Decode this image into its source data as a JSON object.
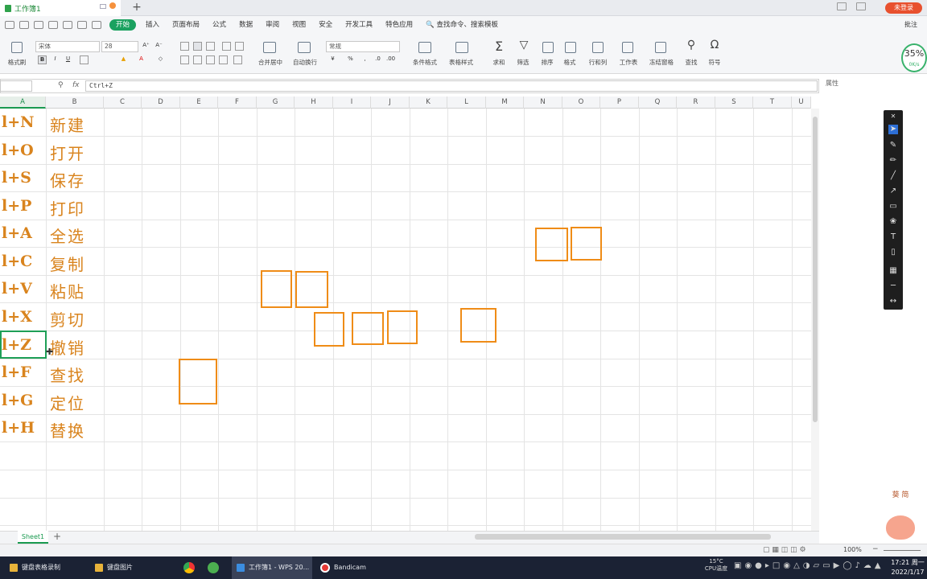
{
  "title_bar": {
    "doc_tab": "工作簿1",
    "login": "未登录"
  },
  "menu": {
    "items": [
      "开始",
      "插入",
      "页面布局",
      "公式",
      "数据",
      "审阅",
      "视图",
      "安全",
      "开发工具",
      "特色应用"
    ],
    "active": "开始",
    "search": "查找命令、搜索模板",
    "annotate": "批注"
  },
  "ribbon": {
    "format_painter": "格式刷",
    "font_name": "宋体",
    "font_size": "28",
    "merge": "合并居中",
    "wrap": "自动换行",
    "number_format": "常规",
    "cond_format": "条件格式",
    "table_style": "表格样式",
    "sum": "求和",
    "filter": "筛选",
    "sort": "排序",
    "format": "格式",
    "rowcol": "行和列",
    "sheet": "工作表",
    "freeze": "冻结窗格",
    "find": "查找",
    "symbol": "符号"
  },
  "perf": {
    "percent": "35%",
    "speed": "0K/s"
  },
  "formula_bar": {
    "fx": "fx",
    "value": "Ctrl+Z",
    "side_label": "属性"
  },
  "columns": [
    "A",
    "B",
    "C",
    "D",
    "E",
    "F",
    "G",
    "H",
    "I",
    "J",
    "K",
    "L",
    "M",
    "N",
    "O",
    "P",
    "Q",
    "R",
    "S",
    "T",
    "U"
  ],
  "rows": [
    {
      "a": "l+N",
      "b": "新建"
    },
    {
      "a": "l+O",
      "b": "打开"
    },
    {
      "a": "l+S",
      "b": "保存"
    },
    {
      "a": "l+P",
      "b": "打印"
    },
    {
      "a": "l+A",
      "b": "全选"
    },
    {
      "a": "l+C",
      "b": "复制"
    },
    {
      "a": "l+V",
      "b": "粘贴"
    },
    {
      "a": "l+X",
      "b": "剪切"
    },
    {
      "a": "l+Z",
      "b": "撤销"
    },
    {
      "a": "l+F",
      "b": "查找"
    },
    {
      "a": "l+G",
      "b": "定位"
    },
    {
      "a": "l+H",
      "b": "替换"
    }
  ],
  "sheet_tab": "Sheet1",
  "status": {
    "zoom": "100%"
  },
  "taskbar": {
    "items": [
      "键盘表格录制",
      "键盘图片",
      "工作簿1 - WPS 20...",
      "Bandicam"
    ],
    "weather": "15°C",
    "cpu": "CPU温度",
    "time": "17:21 周一",
    "date": "2022/1/17"
  },
  "mascot_text": "葵  简"
}
